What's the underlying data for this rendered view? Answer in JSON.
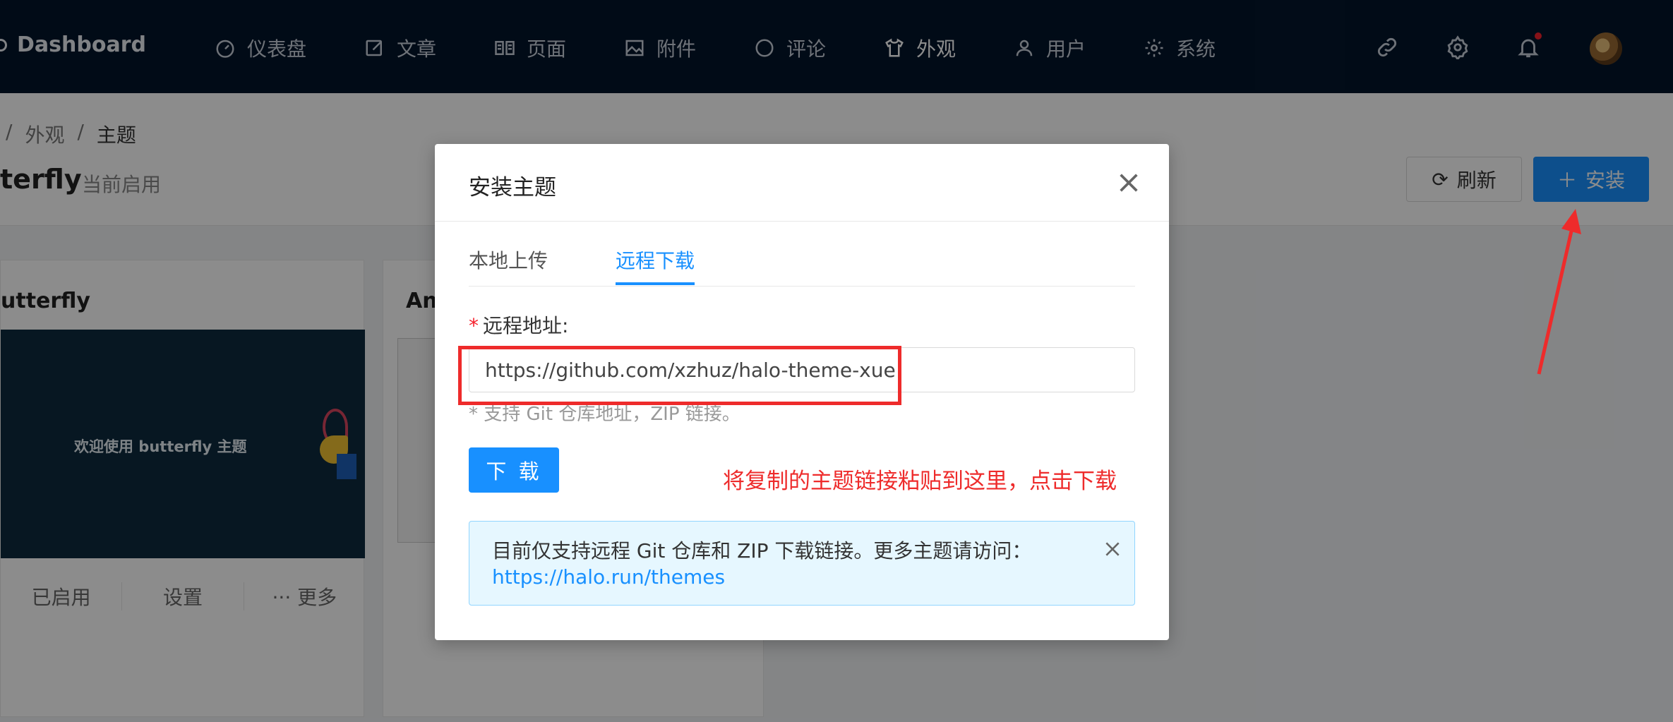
{
  "topnav": {
    "brand": "Dashboard",
    "items": [
      {
        "label": "仪表盘",
        "icon": "dashboard-icon"
      },
      {
        "label": "文章",
        "icon": "edit-icon"
      },
      {
        "label": "页面",
        "icon": "book-icon"
      },
      {
        "label": "附件",
        "icon": "image-icon"
      },
      {
        "label": "评论",
        "icon": "comment-icon"
      },
      {
        "label": "外观",
        "icon": "shirt-icon"
      },
      {
        "label": "用户",
        "icon": "user-icon"
      },
      {
        "label": "系统",
        "icon": "gear-icon"
      }
    ],
    "active": "外观"
  },
  "breadcrumb": {
    "sep": "/",
    "parent": "外观",
    "current": "主题"
  },
  "page": {
    "title": "terfly",
    "subtitle": "当前启用",
    "refresh_label": "刷新",
    "install_label": "安装"
  },
  "cards": [
    {
      "title": "utterfly",
      "welcome": "欢迎使用 butterfly 主题",
      "actions": [
        "已启用",
        "设置",
        "··· 更多"
      ]
    },
    {
      "title": "An"
    }
  ],
  "modal": {
    "title": "安装主题",
    "tabs": [
      "本地上传",
      "远程下载"
    ],
    "active_tab": "远程下载",
    "field_label": "远程地址:",
    "field_value": "https://github.com/xzhuz/halo-theme-xue",
    "field_help": "* 支持 Git 仓库地址，ZIP 链接。",
    "download_label": "下 载",
    "alert_text": "目前仅支持远程 Git 仓库和 ZIP 下载链接。更多主题请访问：",
    "alert_link": "https://halo.run/themes"
  },
  "annotation": {
    "text": "将复制的主题链接粘贴到这里，点击下载",
    "color": "#ee2b2b"
  },
  "colors": {
    "nav_bg": "#03152b",
    "primary": "#1890ff",
    "alert_bg": "#e6f7ff"
  }
}
